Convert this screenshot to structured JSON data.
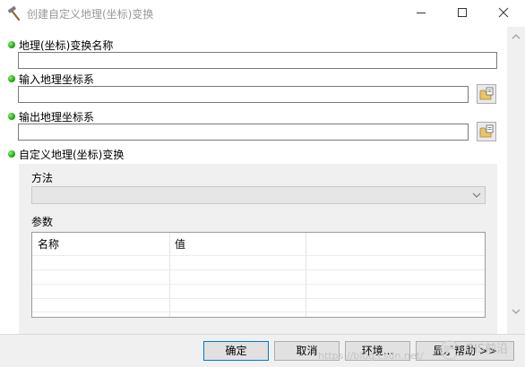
{
  "window": {
    "title": "创建自定义地理(坐标)变换",
    "icon": "hammer-icon"
  },
  "form": {
    "name_label": "地理(坐标)变换名称",
    "name_value": "",
    "input_label": "输入地理坐标系",
    "input_value": "",
    "output_label": "输出地理坐标系",
    "output_value": "",
    "custom_label": "自定义地理(坐标)变换",
    "method_label": "方法",
    "method_value": "",
    "params_label": "参数",
    "params_columns": [
      "名称",
      "值"
    ],
    "params_rows": []
  },
  "buttons": {
    "ok": "确定",
    "cancel": "取消",
    "env": "环境...",
    "help": "显示帮助 >>"
  },
  "watermark": {
    "url": "https://blog.csdn.net/",
    "brand": "GIS前沿"
  }
}
